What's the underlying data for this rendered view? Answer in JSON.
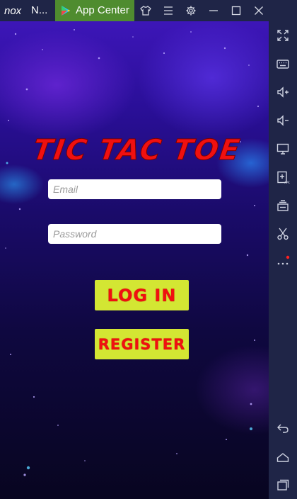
{
  "window": {
    "logo_text": "nox",
    "title": "N...",
    "app_center_label": "App Center"
  },
  "game": {
    "title": "TIC TAC TOE",
    "email_placeholder": "Email",
    "password_placeholder": "Password",
    "login_label": "LOG IN",
    "register_label": "REGISTER"
  },
  "colors": {
    "titlebar_bg": "#1f2547",
    "app_center_bg": "#4f8c2f",
    "button_bg": "#d3e633",
    "title_red": "#f01010"
  },
  "toolbar_icons": [
    "shirt-icon",
    "menu-icon",
    "gear-icon",
    "minimize-icon",
    "maximize-icon",
    "close-icon"
  ],
  "sidebar_icons": [
    "fullscreen-icon",
    "keyboard-icon",
    "volume-up-icon",
    "volume-down-icon",
    "screen-icon",
    "apk-install-icon",
    "multi-instance-icon",
    "scissors-icon",
    "more-icon",
    "back-icon",
    "home-icon",
    "recent-apps-icon"
  ]
}
